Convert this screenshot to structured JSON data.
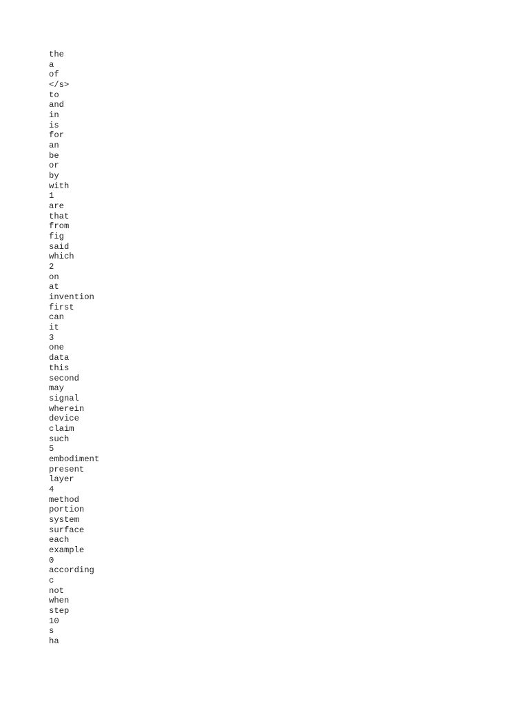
{
  "document": {
    "words": [
      "the",
      "a",
      "of",
      "</s>",
      "to",
      "and",
      "in",
      "is",
      "for",
      "an",
      "be",
      "or",
      "by",
      "with",
      "1",
      "are",
      "that",
      "from",
      "fig",
      "said",
      "which",
      "2",
      "on",
      "at",
      "invention",
      "first",
      "can",
      "it",
      "3",
      "one",
      "data",
      "this",
      "second",
      "may",
      "signal",
      "wherein",
      "device",
      "claim",
      "such",
      "5",
      "embodiment",
      "present",
      "layer",
      "4",
      "method",
      "portion",
      "system",
      "surface",
      "each",
      "example",
      "0",
      "according",
      "c",
      "not",
      "when",
      "step",
      "10",
      "s",
      "ha"
    ]
  }
}
